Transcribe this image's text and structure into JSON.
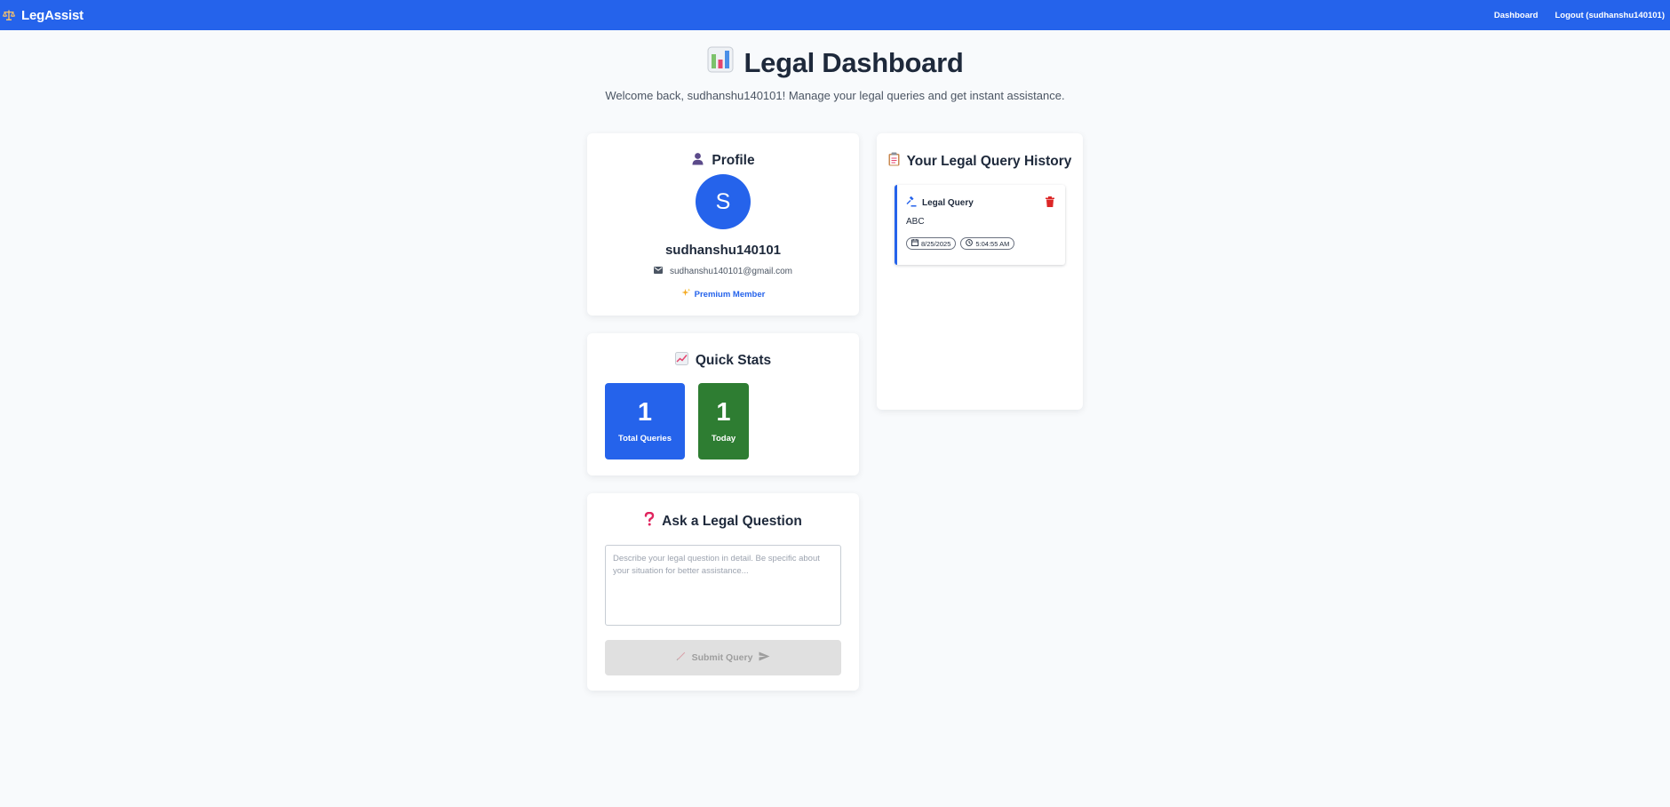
{
  "navbar": {
    "brand": "LegAssist",
    "brand_icon": "scales-icon",
    "links": {
      "dashboard": "Dashboard",
      "logout": "Logout (sudhanshu140101)"
    },
    "color": "#2563eb"
  },
  "header": {
    "title": "Legal Dashboard",
    "title_icon": "bar-chart-icon",
    "subtitle": "Welcome back, sudhanshu140101! Manage your legal queries and get instant assistance."
  },
  "profile": {
    "title": "Profile",
    "title_icon": "person-icon",
    "avatar_letter": "S",
    "username": "sudhanshu140101",
    "email": "sudhanshu140101@gmail.com",
    "membership": "Premium Member",
    "membership_icon": "sparkles-icon"
  },
  "stats": {
    "title": "Quick Stats",
    "title_icon": "trending-chart-icon",
    "total_value": "1",
    "total_label": "Total Queries",
    "today_value": "1",
    "today_label": "Today",
    "total_color": "#2563eb",
    "today_color": "#2e7d32"
  },
  "ask": {
    "title": "Ask a Legal Question",
    "title_icon": "question-mark-icon",
    "placeholder": "Describe your legal question in detail. Be specific about your situation for better assistance...",
    "submit_label": "Submit Query"
  },
  "history": {
    "title": "Your Legal Query History",
    "title_icon": "clipboard-icon",
    "items": [
      {
        "title": "Legal Query",
        "text": "ABC",
        "date": "8/25/2025",
        "time": "5:04:55 AM"
      }
    ]
  }
}
